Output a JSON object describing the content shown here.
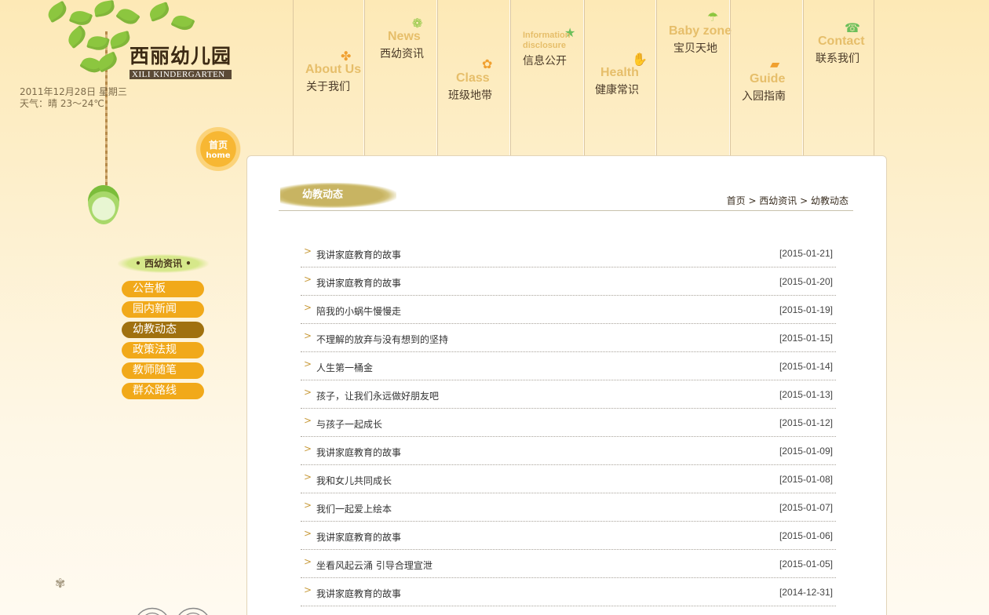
{
  "logo": {
    "cn": "西丽幼儿园",
    "en": "XILI KINDERGARTEN"
  },
  "date_info": {
    "date": "2011年12月28日 星期三",
    "weather": "天气：晴 23～24℃"
  },
  "home_button": {
    "cn": "首页",
    "en": "home"
  },
  "nav": {
    "items": [
      {
        "en": "About Us",
        "cn": "关于我们",
        "icon": "maple-leaf-icon"
      },
      {
        "en": "News",
        "cn": "西幼资讯",
        "icon": "flower-icon"
      },
      {
        "en": "Class",
        "cn": "班级地带",
        "icon": "clover-icon"
      },
      {
        "en": "Information",
        "en2": "disclosure",
        "cn": "信息公开",
        "icon": "star-icon"
      },
      {
        "en": "Health",
        "cn": "健康常识",
        "icon": "hand-icon"
      },
      {
        "en": "Baby zone",
        "cn": "宝贝天地",
        "icon": "umbrella-icon"
      },
      {
        "en": "Guide",
        "cn": "入园指南",
        "icon": "car-icon"
      },
      {
        "en": "Contact",
        "cn": "联系我们",
        "icon": "phone-icon"
      }
    ]
  },
  "sidebar": {
    "title": "• 西幼资讯 •",
    "items": [
      {
        "label": "公告板",
        "active": false
      },
      {
        "label": "园内新闻",
        "active": false
      },
      {
        "label": "幼教动态",
        "active": true
      },
      {
        "label": "政策法规",
        "active": false
      },
      {
        "label": "教师随笔",
        "active": false
      },
      {
        "label": "群众路线",
        "active": false
      }
    ]
  },
  "main": {
    "title": "幼教动态",
    "breadcrumb": "首页 > 西幼资讯 > 幼教动态",
    "articles": [
      {
        "title": "我讲家庭教育的故事",
        "date": "[2015-01-21]"
      },
      {
        "title": "我讲家庭教育的故事",
        "date": "[2015-01-20]"
      },
      {
        "title": "陪我的小蜗牛慢慢走",
        "date": "[2015-01-19]"
      },
      {
        "title": "不理解的放弃与没有想到的坚持",
        "date": "[2015-01-15]"
      },
      {
        "title": "人生第一桶金",
        "date": "[2015-01-14]"
      },
      {
        "title": "孩子，让我们永远做好朋友吧",
        "date": "[2015-01-13]"
      },
      {
        "title": "与孩子一起成长",
        "date": "[2015-01-12]"
      },
      {
        "title": "我讲家庭教育的故事",
        "date": "[2015-01-09]"
      },
      {
        "title": "我和女儿共同成长",
        "date": "[2015-01-08]"
      },
      {
        "title": "我们一起爱上绘本",
        "date": "[2015-01-07]"
      },
      {
        "title": "我讲家庭教育的故事",
        "date": "[2015-01-06]"
      },
      {
        "title": "坐看风起云涌 引导合理宣泄",
        "date": "[2015-01-05]"
      },
      {
        "title": "我讲家庭教育的故事",
        "date": "[2014-12-31]"
      }
    ]
  },
  "colors": {
    "accent": "#f1a91a",
    "active": "#a0710f",
    "nav_en": "#e6be6a"
  }
}
